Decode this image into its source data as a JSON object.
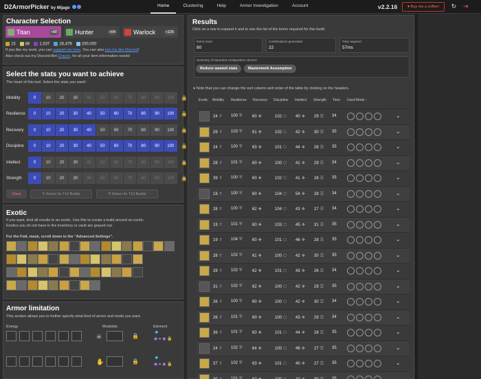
{
  "brand": {
    "title": "D2ArmorPicker",
    "by": "by Mijago"
  },
  "nav": [
    "Home",
    "Clustering",
    "Help",
    "Armor Investigation",
    "Account"
  ],
  "version": "v2.2.16",
  "coffee": "Buy me a coffee!",
  "character": {
    "title": "Character Selection",
    "chars": [
      {
        "name": "Titan",
        "count": "+88",
        "color": "#a84a9a"
      },
      {
        "name": "Hunter",
        "count": "+64",
        "color": "#444"
      },
      {
        "name": "Warlock",
        "count": "+126",
        "color": "#444"
      }
    ],
    "resources": [
      {
        "value": "15",
        "color": "#c9a23a"
      },
      {
        "value": "88",
        "color": "#d9c066"
      },
      {
        "value": "1,537",
        "color": "#8a3fbd"
      },
      {
        "value": "26,479",
        "color": "#5aa0d6"
      },
      {
        "value": "200,000",
        "color": "#7cc4f0"
      }
    ],
    "line1a": "If you like my work, you can",
    "line1link1": "support me here",
    "line1b": ". You can also",
    "line1link2": "join my dev Discord",
    "line1c": "!",
    "line2a": "Also check out my Discord-Bot",
    "line2link": "Crayon",
    "line2b": ", for all your item information needs!"
  },
  "stats": {
    "title": "Select the stats you want to achieve",
    "subtitle": "The heart of this tool. Select the stats you want!",
    "values": [
      "0",
      "10",
      "20",
      "30",
      "40",
      "50",
      "60",
      "70",
      "80",
      "90",
      "100"
    ],
    "rows": [
      {
        "label": "Mobility",
        "selected": 1,
        "max": 4
      },
      {
        "label": "Resilience",
        "selected": 11,
        "max": 11
      },
      {
        "label": "Recovery",
        "selected": 5,
        "max": 11
      },
      {
        "label": "Discipline",
        "selected": 11,
        "max": 11
      },
      {
        "label": "Intellect",
        "selected": 1,
        "max": 4
      },
      {
        "label": "Strength",
        "selected": 1,
        "max": 4
      }
    ],
    "clear": "Clear",
    "select3": "Select 3x T10 Builds",
    "select4": "Select 4x T10 Builds"
  },
  "exotic": {
    "title": "Exotic",
    "desc1": "If you want, limit all results to an exotic. Use this to create a build around an exotic.",
    "desc2": "Exotics you do not have in the inventory or vault are grayed out.",
    "note": "For the FotL mask, scroll down to the \"Advanced Settings\"."
  },
  "armor": {
    "title": "Armor limitation",
    "desc": "This section allows you to further specify what kind of armor and mods you want.",
    "energy": "Energy",
    "modslots": "Modslots",
    "element": "Element"
  },
  "results": {
    "title": "Results",
    "desc": "Click on a row to expand it and to see the list of the items required for this build.",
    "cards": [
      {
        "label": "Items Used",
        "value": "80"
      },
      {
        "label": "Combinations generated",
        "value": "22"
      },
      {
        "label": "Time required",
        "value": "57ms"
      }
    ],
    "summary": "Summary of important configuration choices",
    "pills": [
      "Reduce wasted stats",
      "Masterwork Assumption"
    ],
    "note": "Note that you can change the sort column and order of the table by clicking on the headers.",
    "headers": [
      "Exotic",
      "Mobility",
      "Resilience",
      "Recovery",
      "Discipline",
      "Intellect",
      "Strength",
      "Tiers",
      "Used Mods ↑"
    ],
    "rows": [
      [
        "24",
        "100",
        "60",
        "102",
        "40",
        "29",
        "34"
      ],
      [
        "29",
        "103",
        "61",
        "102",
        "42",
        "30",
        "35"
      ],
      [
        "24",
        "100",
        "63",
        "101",
        "44",
        "28",
        "35"
      ],
      [
        "28",
        "101",
        "60",
        "100",
        "41",
        "29",
        "34"
      ],
      [
        "39",
        "100",
        "60",
        "102",
        "41",
        "28",
        "35"
      ],
      [
        "18",
        "100",
        "60",
        "104",
        "54",
        "28",
        "34"
      ],
      [
        "28",
        "100",
        "62",
        "104",
        "43",
        "27",
        "34"
      ],
      [
        "19",
        "101",
        "60",
        "103",
        "45",
        "31",
        "35"
      ],
      [
        "19",
        "104",
        "60",
        "101",
        "46",
        "28",
        "35"
      ],
      [
        "28",
        "102",
        "61",
        "100",
        "42",
        "30",
        "35"
      ],
      [
        "28",
        "102",
        "62",
        "101",
        "43",
        "26",
        "34"
      ],
      [
        "31",
        "102",
        "62",
        "100",
        "42",
        "29",
        "35"
      ],
      [
        "26",
        "100",
        "60",
        "100",
        "42",
        "30",
        "34"
      ],
      [
        "26",
        "101",
        "60",
        "100",
        "43",
        "29",
        "34"
      ],
      [
        "36",
        "101",
        "60",
        "101",
        "44",
        "28",
        "35"
      ],
      [
        "24",
        "102",
        "64",
        "100",
        "46",
        "27",
        "35"
      ],
      [
        "37",
        "102",
        "63",
        "101",
        "40",
        "27",
        "35"
      ],
      [
        "30",
        "101",
        "62",
        "100",
        "42",
        "30",
        "35"
      ]
    ]
  }
}
